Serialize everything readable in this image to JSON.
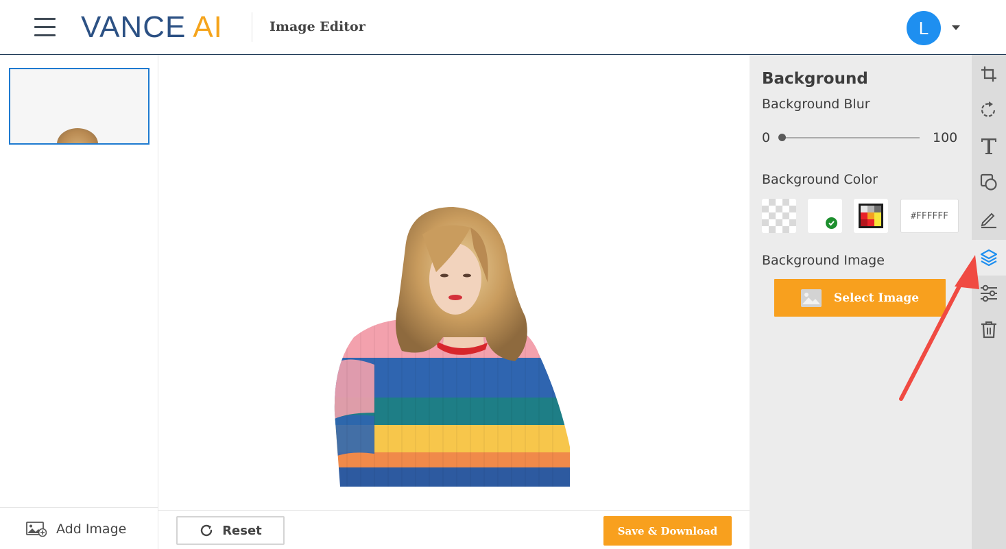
{
  "header": {
    "logo_primary": "VANCE",
    "logo_secondary": "AI",
    "app_title": "Image Editor",
    "user_initial": "L"
  },
  "left_panel": {
    "add_image_label": "Add Image"
  },
  "bottom_bar": {
    "reset_label": "Reset",
    "save_label": "Save & Download"
  },
  "right_panel": {
    "title": "Background",
    "blur": {
      "label": "Background Blur",
      "min": "0",
      "max": "100",
      "value": 0
    },
    "color": {
      "label": "Background Color",
      "hex_value": "#FFFFFF",
      "selected_swatch": "white"
    },
    "image": {
      "label": "Background Image",
      "select_label": "Select Image"
    }
  },
  "tools": [
    {
      "name": "crop-icon",
      "active": false
    },
    {
      "name": "rotate-icon",
      "active": false
    },
    {
      "name": "text-icon",
      "active": false
    },
    {
      "name": "shapes-icon",
      "active": false
    },
    {
      "name": "draw-icon",
      "active": false
    },
    {
      "name": "layers-icon",
      "active": true
    },
    {
      "name": "adjust-icon",
      "active": false
    },
    {
      "name": "delete-icon",
      "active": false
    }
  ],
  "colors": {
    "brand_blue": "#2c5184",
    "brand_orange": "#f5a41c",
    "accent_orange": "#f8a01e",
    "active_tool_blue": "#1e8ff0",
    "annotation_red": "#f04a42"
  }
}
